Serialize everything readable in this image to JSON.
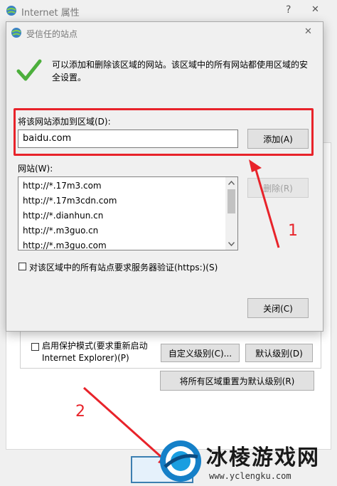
{
  "parent_window": {
    "title": "Internet 属性",
    "help_glyph": "?",
    "close_glyph": "✕",
    "protected_mode_label": "启用保护模式(要求重新启动 Internet Explorer)(P)",
    "custom_level_label": "自定义级别(C)...",
    "default_level_label": "默认级别(D)",
    "reset_all_label": "将所有区域重置为默认级别(R)"
  },
  "dialog": {
    "title": "受信任的站点",
    "close_glyph": "✕",
    "description": "可以添加和删除该区域的网站。该区域中的所有网站都使用区域的安全设置。",
    "add_label": "将该网站添加到区域(D):",
    "add_input_value": "baidu.com",
    "add_button": "添加(A)",
    "websites_label": "网站(W):",
    "websites": [
      "http://*.17m3.com",
      "http://*.17m3cdn.com",
      "http://*.dianhun.cn",
      "http://*.m3guo.cn",
      "http://*.m3guo.com"
    ],
    "remove_button": "删除(R)",
    "require_https_label": "对该区域中的所有站点要求服务器验证(https:)(S)",
    "close_button": "关闭(C)"
  },
  "annotations": {
    "step1": "1",
    "step2": "2",
    "highlight_color": "#e8232a"
  },
  "watermark": {
    "brand": "冰棱游戏网",
    "url": "www.yclengku.com"
  }
}
